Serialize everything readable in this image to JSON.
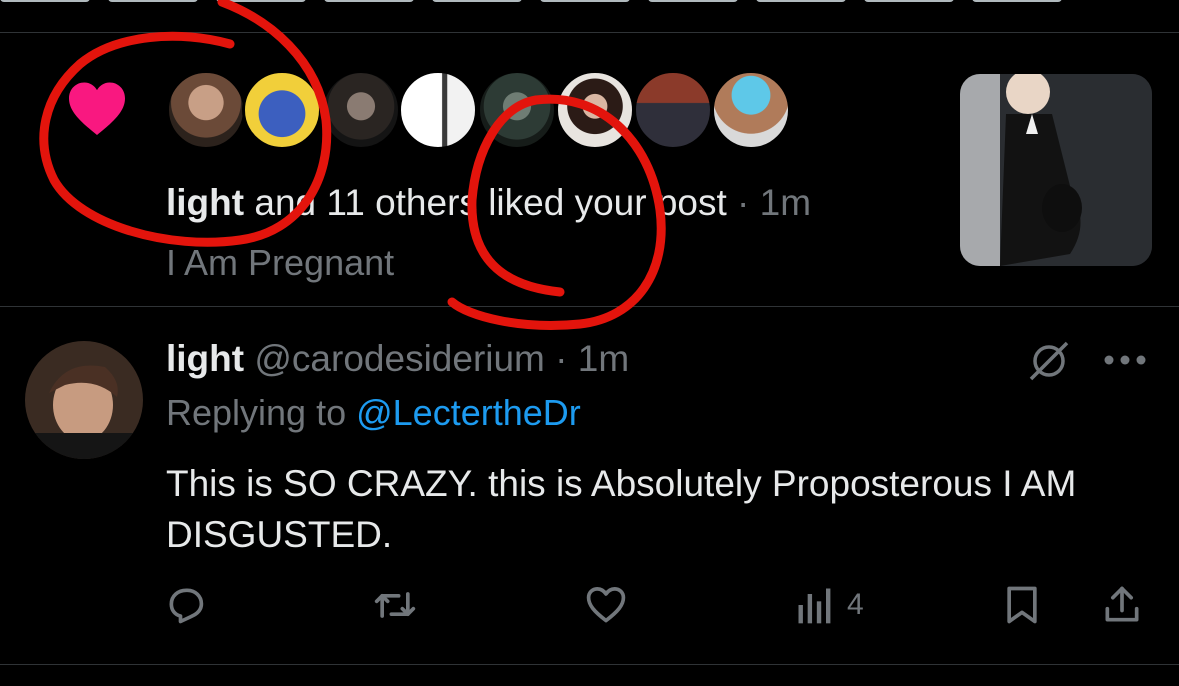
{
  "like_notification": {
    "liker_name": "light",
    "rest_text": " and 11 others liked your post",
    "separator": " · ",
    "time": "1m",
    "post_title": "I Am Pregnant",
    "heart_color": "#f91880",
    "avatar_count": 8
  },
  "reply": {
    "display_name": "light",
    "handle": "@carodesiderium",
    "separator": " · ",
    "time": "1m",
    "replying_label": "Replying to ",
    "replying_to": "@LectertheDr",
    "text": "This is SO CRAZY. this is Absolutely Proposterous I AM DISGUSTED.",
    "actions": {
      "reply_icon": "reply-icon",
      "repost_icon": "repost-icon",
      "like_icon": "like-icon",
      "views_icon": "views-icon",
      "views_count": "4",
      "bookmark_icon": "bookmark-icon",
      "share_icon": "share-icon"
    }
  },
  "annotation_color": "#e3140c"
}
